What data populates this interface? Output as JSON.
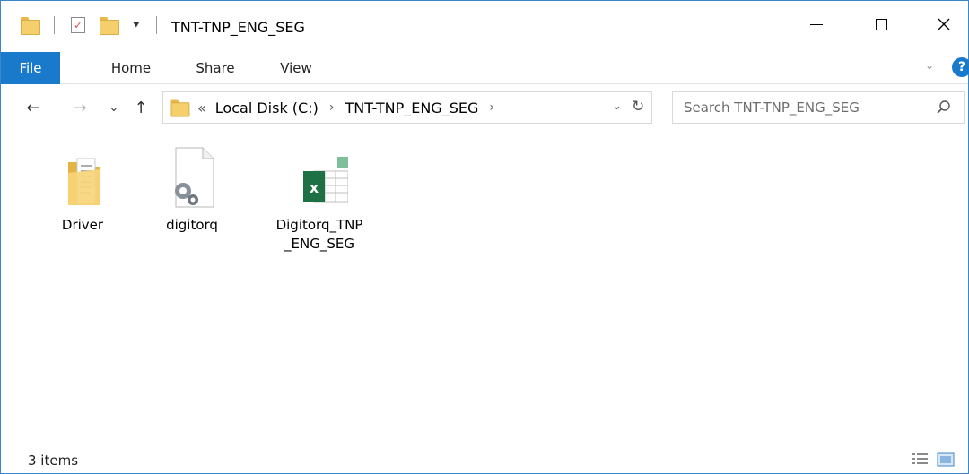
{
  "window": {
    "title": "TNT-TNP_ENG_SEG",
    "controls": {
      "minimize": "—",
      "maximize": "☐",
      "close": "✕"
    }
  },
  "ribbon": {
    "tabs": [
      {
        "label": "File",
        "active": true
      },
      {
        "label": "Home"
      },
      {
        "label": "Share"
      },
      {
        "label": "View"
      }
    ],
    "help": "?"
  },
  "nav": {
    "back": "←",
    "forward": "→",
    "recent": "⌄",
    "up": "↑",
    "breadcrumb": {
      "overflow": "«",
      "items": [
        "Local Disk (C:)",
        "TNT-TNP_ENG_SEG"
      ],
      "separator": "›"
    },
    "refresh": "↻"
  },
  "search": {
    "placeholder": "Search TNT-TNP_ENG_SEG",
    "value": ""
  },
  "files": [
    {
      "name": "Driver",
      "type": "folder",
      "icon": "folder-icon"
    },
    {
      "name": "digitorq",
      "type": "config",
      "icon": "settings-file-icon"
    },
    {
      "name": "Digitorq_TNP_ENG_SEG",
      "type": "excel",
      "icon": "excel-file-icon"
    }
  ],
  "status": {
    "items_count": "3 items"
  },
  "colors": {
    "accent": "#1979ca",
    "folder": "#f5cf6b",
    "excel": "#1e7145"
  }
}
